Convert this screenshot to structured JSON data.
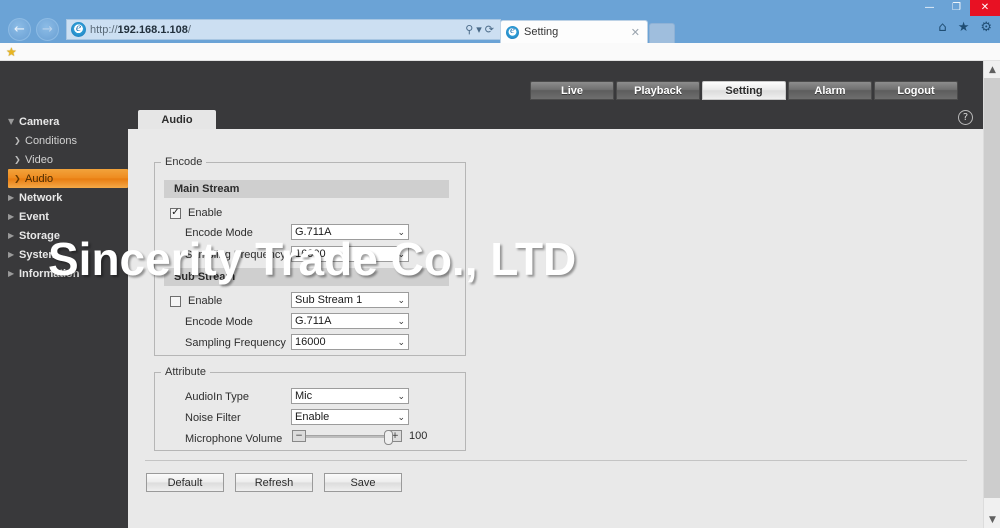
{
  "browser": {
    "window_controls": {
      "minimize": "—",
      "maximize": "❐",
      "close": "✕"
    },
    "nav": {
      "back": "←",
      "forward": "→"
    },
    "address": {
      "scheme": "http://",
      "host": "192.168.1.108",
      "path": "/"
    },
    "address_icons": {
      "search": "⚲",
      "dropdown": "▾",
      "refresh": "⟳"
    },
    "tab": {
      "title": "Setting",
      "close": "✕"
    },
    "chrome_icons": {
      "home": "⌂",
      "favorites": "★",
      "tools": "⚙"
    },
    "favbar": {
      "star": "★"
    }
  },
  "topnav": {
    "tabs": [
      {
        "label": "Live",
        "active": false
      },
      {
        "label": "Playback",
        "active": false
      },
      {
        "label": "Setting",
        "active": true
      },
      {
        "label": "Alarm",
        "active": false
      },
      {
        "label": "Logout",
        "active": false
      }
    ]
  },
  "sidebar": {
    "items": [
      {
        "label": "Camera",
        "caret": "▼",
        "level": "top",
        "selected": false
      },
      {
        "label": "Conditions",
        "caret": "❯",
        "level": "sub",
        "selected": false
      },
      {
        "label": "Video",
        "caret": "❯",
        "level": "sub",
        "selected": false
      },
      {
        "label": "Audio",
        "caret": "❯",
        "level": "sub",
        "selected": true
      },
      {
        "label": "Network",
        "caret": "▶",
        "level": "top",
        "selected": false
      },
      {
        "label": "Event",
        "caret": "▶",
        "level": "top",
        "selected": false
      },
      {
        "label": "Storage",
        "caret": "▶",
        "level": "top",
        "selected": false
      },
      {
        "label": "System",
        "caret": "▶",
        "level": "top",
        "selected": false
      },
      {
        "label": "Information",
        "caret": "▶",
        "level": "top",
        "selected": false
      }
    ]
  },
  "content": {
    "tab_label": "Audio",
    "help_glyph": "?",
    "encode": {
      "legend": "Encode",
      "main_stream": {
        "header": "Main Stream",
        "enable_label": "Enable",
        "enable_checked": true,
        "check_glyph": "✓",
        "encode_mode_label": "Encode Mode",
        "encode_mode_value": "G.711A",
        "sampling_label": "Sampling Frequency",
        "sampling_value": "16000"
      },
      "sub_stream": {
        "header": "Sub Stream",
        "enable_label": "Enable",
        "enable_checked": false,
        "stream_select_value": "Sub Stream 1",
        "encode_mode_label": "Encode Mode",
        "encode_mode_value": "G.711A",
        "sampling_label": "Sampling Frequency",
        "sampling_value": "16000"
      }
    },
    "attribute": {
      "legend": "Attribute",
      "audioin_label": "AudioIn Type",
      "audioin_value": "Mic",
      "noise_label": "Noise Filter",
      "noise_value": "Enable",
      "volume_label": "Microphone Volume",
      "volume_value": "100",
      "minus_glyph": "−",
      "plus_glyph": "+"
    },
    "buttons": {
      "default": "Default",
      "refresh": "Refresh",
      "save": "Save"
    },
    "dropdown_arrow": "⌄"
  },
  "watermark": {
    "text": "Sincerity Trade Co., LTD"
  },
  "colors": {
    "accent_orange": "#ee8a1e",
    "chrome_blue": "#6ba3d6",
    "panel_dark": "#39393b",
    "panel_light": "#e9e9e9",
    "close_red": "#e81123"
  }
}
